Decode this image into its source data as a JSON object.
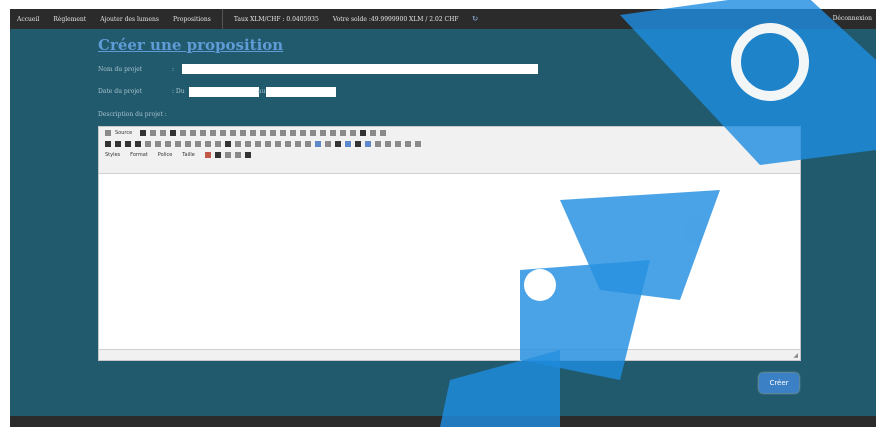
{
  "topbar": {
    "nav_items": [
      "Accueil",
      "Règlement",
      "Ajouter des lumens",
      "Propositions"
    ],
    "rate_text": "Taux XLM/CHF : 0.0405935",
    "balance_text": "Votre solde :49.9999900 XLM / 2.02 CHF",
    "logout_label": "Déconnexion",
    "refresh_icon": "refresh-icon"
  },
  "page": {
    "title": "Créer une proposition"
  },
  "form": {
    "project_name_label": "Nom du projet",
    "project_name_colon": ":",
    "project_name_value": "",
    "project_date_label": "Date du projet",
    "date_from_label": ": Du",
    "date_to_label": "au",
    "date_from_value": "",
    "date_to_value": "",
    "description_label": "Description du projet  :"
  },
  "editor": {
    "source_label": "Source",
    "styles_label": "Styles",
    "format_label": "Format",
    "font_label": "Police",
    "size_label": "Taille",
    "content": ""
  },
  "actions": {
    "create_label": "Créer"
  },
  "colors": {
    "page_bg": "#215a6d",
    "topbar_bg": "#2b2b2b",
    "title": "#5f9bd6",
    "button_bg": "#3b7fc4"
  }
}
